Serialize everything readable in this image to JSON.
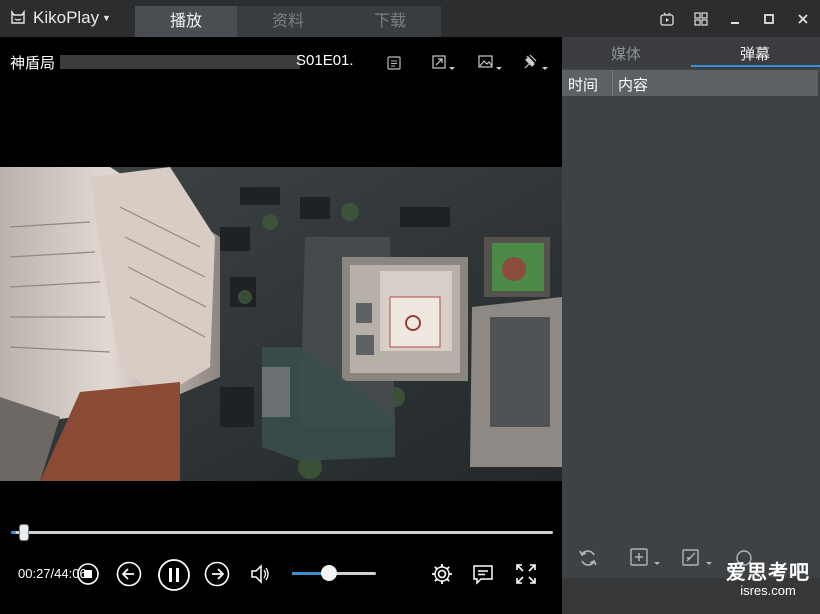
{
  "app": {
    "name": "KikoPlay",
    "logo_icon": "cat-logo-icon",
    "menu_icon": "caret-down-icon"
  },
  "tabs": [
    {
      "label": "播放",
      "active": true
    },
    {
      "label": "资料",
      "active": false
    },
    {
      "label": "下载",
      "active": false
    }
  ],
  "window_controls": [
    "tv-icon",
    "grid-icon",
    "minimize-icon",
    "maximize-icon",
    "close-icon"
  ],
  "player": {
    "title_start": "神盾局",
    "title_end": "S01E01.",
    "top_icons": [
      "playlist-icon",
      "window-mode-icon",
      "screenshot-icon",
      "pin-icon"
    ],
    "time": "00:27/44:06",
    "progress": 0.01,
    "volume": 0.34,
    "controls": [
      "stop-icon",
      "prev-icon",
      "pause-icon",
      "next-icon",
      "volume-icon",
      "settings-icon",
      "danmaku-icon",
      "fullscreen-icon"
    ]
  },
  "side": {
    "tabs": [
      {
        "label": "媒体",
        "active": false
      },
      {
        "label": "弹幕",
        "active": true
      }
    ],
    "columns": [
      "时间",
      "内容"
    ],
    "bottom_icons": [
      "refresh-icon",
      "add-icon",
      "edit-icon",
      "more-icon"
    ]
  },
  "watermark": {
    "main": "爱思考吧",
    "sub": "isres.com"
  },
  "colors": {
    "accent": "#3a8fd0",
    "player_bg": "#000000",
    "panel_bg": "#3f4244"
  }
}
